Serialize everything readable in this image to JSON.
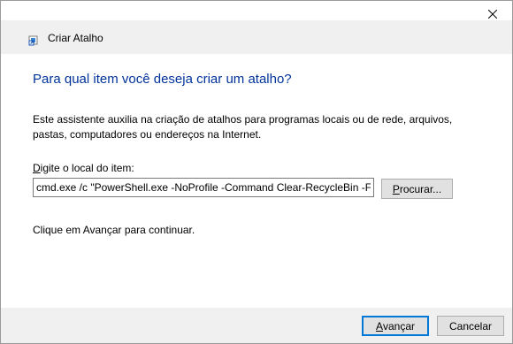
{
  "window": {
    "title": "Criar Atalho",
    "close_icon": "close-icon",
    "app_icon": "shortcut-icon"
  },
  "content": {
    "heading": "Para qual item você deseja criar um atalho?",
    "description": "Este assistente auxilia na criação de atalhos para programas locais ou de rede, arquivos, pastas, computadores ou endereços na Internet.",
    "field_label_underlined": "D",
    "field_label_rest": "igite o local do item:",
    "location_value": "cmd.exe /c \"PowerShell.exe -NoProfile -Command Clear-RecycleBin -Force\"",
    "browse_underlined": "P",
    "browse_rest": "rocurar...",
    "hint": "Clique em Avançar para continuar."
  },
  "footer": {
    "next_underlined": "A",
    "next_rest": "vançar",
    "cancel_label": "Cancelar"
  },
  "colors": {
    "heading": "#003399",
    "default_button_border": "#0078d7",
    "band_background": "#f0f0f0"
  }
}
